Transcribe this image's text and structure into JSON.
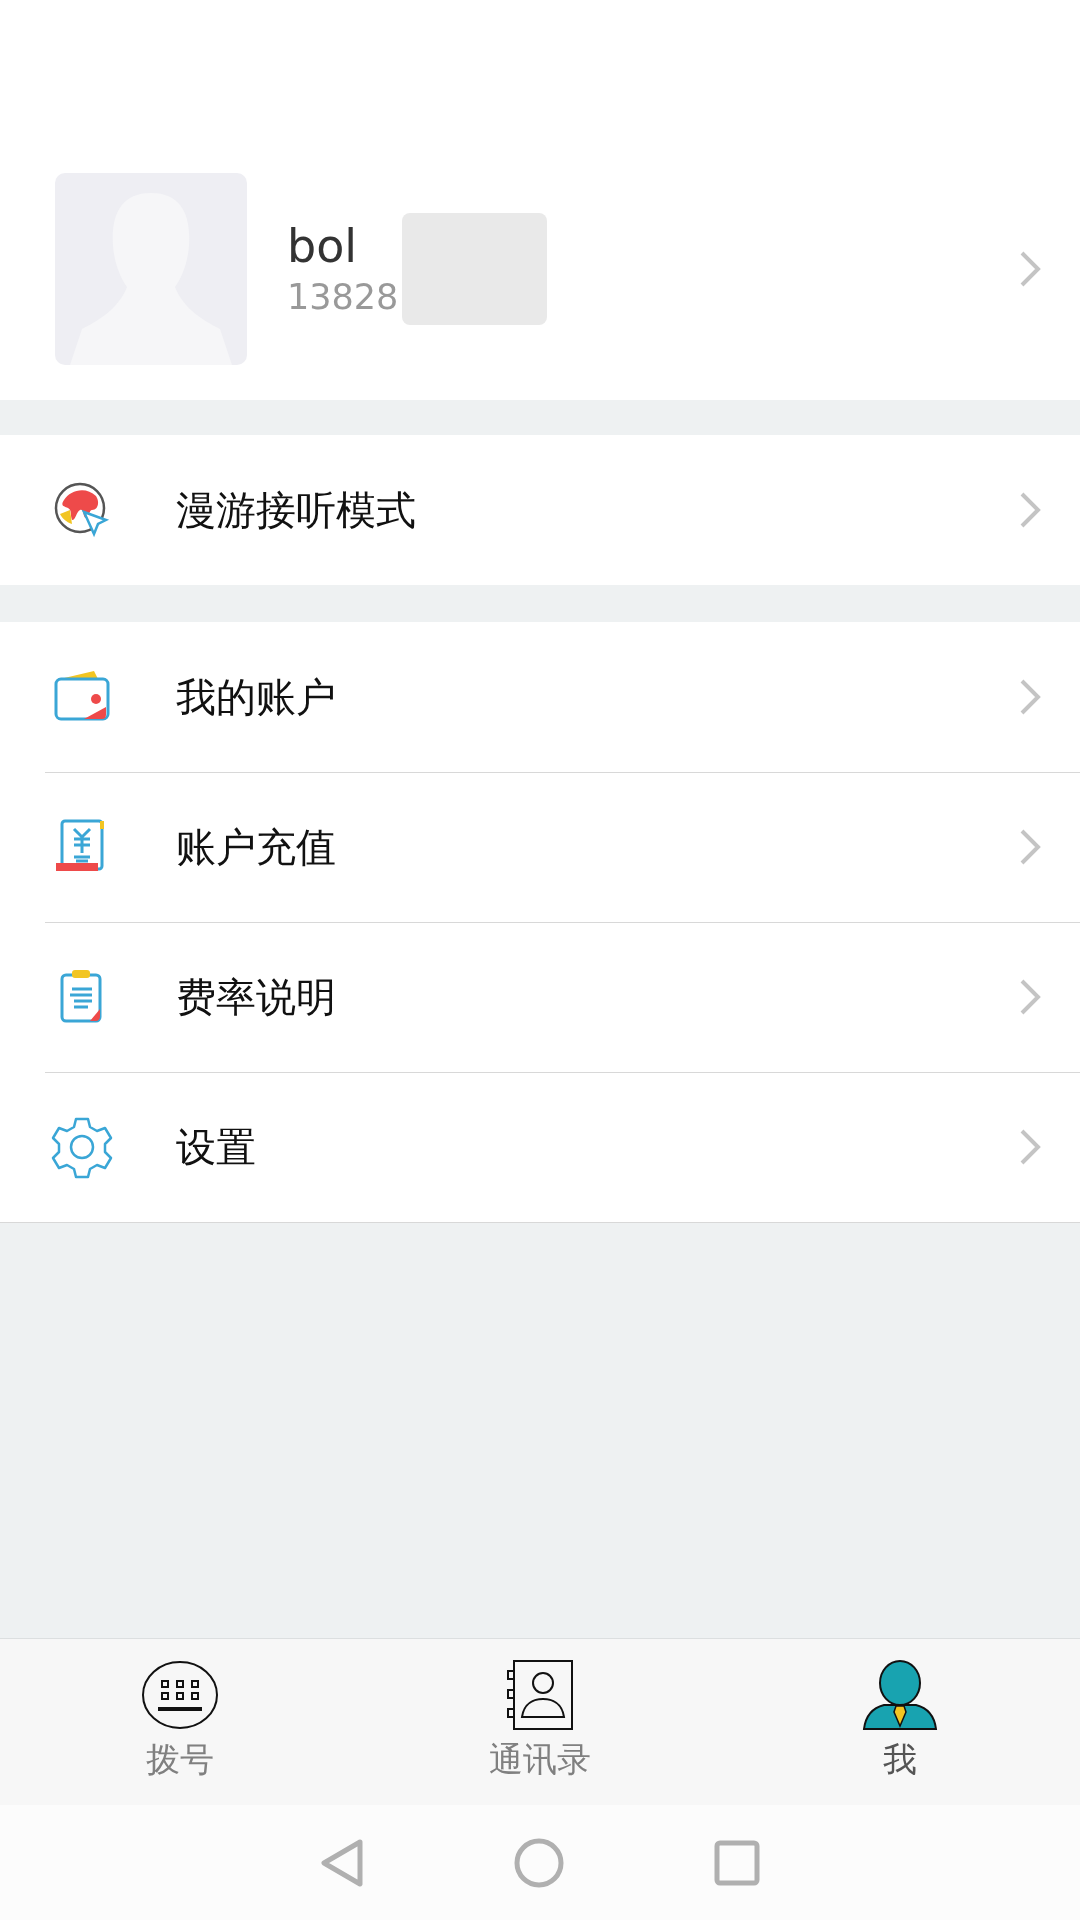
{
  "profile": {
    "name": "bol",
    "phone": "13828"
  },
  "menu_groups": [
    [
      {
        "kind": "roaming",
        "label": "漫游接听模式"
      }
    ],
    [
      {
        "kind": "wallet",
        "label": "我的账户"
      },
      {
        "kind": "recharge",
        "label": "账户充值"
      },
      {
        "kind": "rates",
        "label": "费率说明"
      },
      {
        "kind": "settings",
        "label": "设置"
      }
    ]
  ],
  "tabs": [
    {
      "kind": "dialpad",
      "label": "拨号",
      "selected": false
    },
    {
      "kind": "contacts",
      "label": "通讯录",
      "selected": false
    },
    {
      "kind": "me",
      "label": "我",
      "selected": true
    }
  ]
}
